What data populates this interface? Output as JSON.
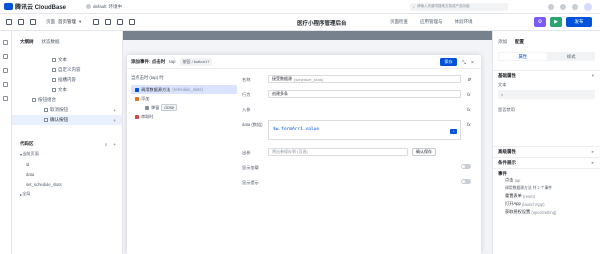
{
  "brand": {
    "name": "腾讯云 CloudBase",
    "color": "#0052d9"
  },
  "env": {
    "name": "default",
    "status": "环境中"
  },
  "search": {
    "placeholder": "请输入关键词搜索文档或产品功能"
  },
  "toolbar": {
    "page_label": "页面",
    "page_name": "首页管理",
    "app_title": "医疗小程序管理后台",
    "link_pages": "页面检查",
    "link_apps": "应用管理与",
    "link_env": "体验环境",
    "publish_label": "发布"
  },
  "left": {
    "tab_outline": "大纲树",
    "tab_state": "状态数据",
    "tree": [
      "文本",
      "自定义内容",
      "插槽内容",
      "文本",
      "按钮组合",
      "取消按钮",
      "确认按钮"
    ],
    "code_section": "代码区",
    "code_group": "当前页面",
    "code_items": [
      "id",
      "data",
      "set_schedule_slots"
    ],
    "global": "全局"
  },
  "dialog": {
    "title": "添加事件: 点击时",
    "event_key": "tap",
    "path": "按钮 / button17",
    "save": "保存",
    "flow_title": "当点击时 (tap) 时",
    "flow_nodes": [
      "调用数据源方法",
      "添加",
      "弹窗",
      "close",
      "串联"
    ],
    "flow_items": [
      {
        "label": "调用数据源方法",
        "sub": "(schedule_slots)"
      },
      {
        "label": "添加"
      },
      {
        "label": "弹窗",
        "chip": "close"
      },
      {
        "label": "串联时"
      }
    ],
    "form": {
      "name_label": "名称",
      "name_value": "接受数据源",
      "name_hint": "(schedule_slots)",
      "op_label": "行为",
      "op_value": "创建多条",
      "params_label": "入参",
      "data_label": "data (数组)",
      "data_value": "$w.formArr1.value",
      "var_label": "出参",
      "var_placeholder": "将出参保存到 (可选)",
      "var_button": "确认保存",
      "toggle1_label": "显示加载",
      "toggle2_label": "显示提示"
    }
  },
  "right": {
    "tab_add": "添加",
    "tab_config": "配置",
    "seg_prop": "属性",
    "seg_style": "样式",
    "sec_basic": "基础属性",
    "field_text": "文本",
    "field_text_value": "x",
    "field_disabled": "是否禁用",
    "sec_advanced": "高级属性",
    "sec_condition": "条件展示",
    "sec_events": "事件",
    "events": [
      {
        "name": "点击",
        "sub": "tap",
        "detail": "调用数据源方法 共 2 个事件"
      },
      {
        "name": "重置表单",
        "sub": "(reset)"
      },
      {
        "name": "打开App",
        "sub": "(launchApp)"
      },
      {
        "name": "获取授权设置",
        "sub": "(openSetting)"
      }
    ]
  }
}
